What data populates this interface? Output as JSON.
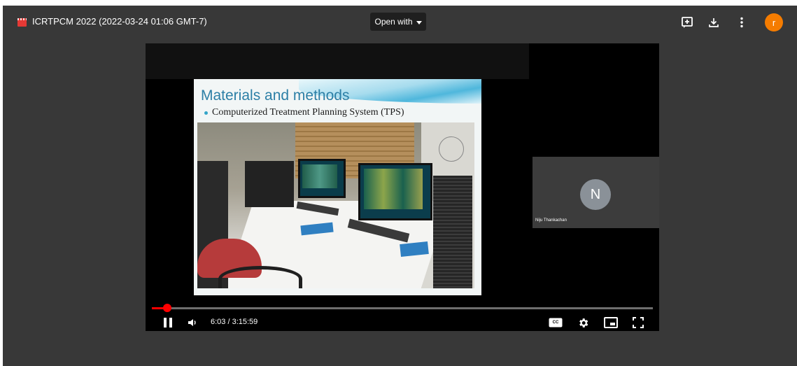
{
  "header": {
    "file_title": "ICRTPCM 2022 (2022-03-24 01:06 GMT-7)",
    "open_with_label": "Open with",
    "avatar_letter": "r"
  },
  "slide": {
    "title": "Materials and methods",
    "bullet": "Computerized Treatment Planning System (TPS)"
  },
  "participant": {
    "initial": "N",
    "name": "Niju Thankachan"
  },
  "player": {
    "time": "6:03 / 3:15:59",
    "progress_fraction": 0.031,
    "cc_label": "CC"
  },
  "colors": {
    "accent_red": "#ff0000",
    "avatar_orange": "#f57c00"
  }
}
